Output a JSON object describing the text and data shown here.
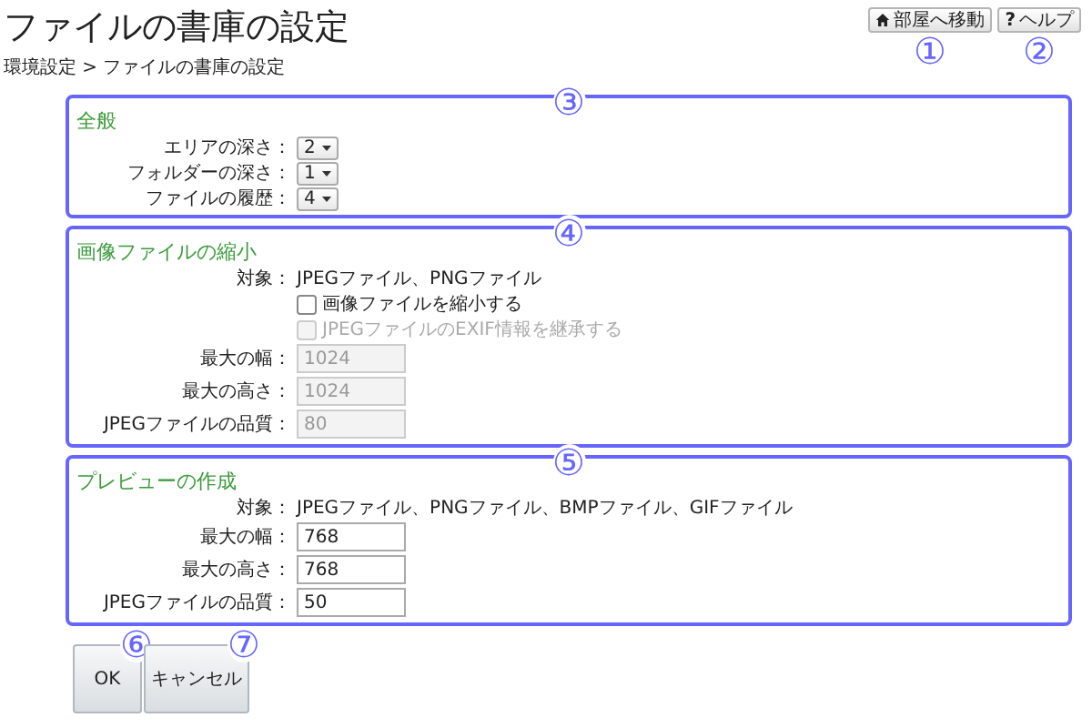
{
  "header": {
    "title": "ファイルの書庫の設定",
    "buttons": [
      {
        "kind": "home",
        "label": "部屋へ移動",
        "callout": "①"
      },
      {
        "kind": "help",
        "icon": "?",
        "label": "ヘルプ",
        "callout": "②"
      }
    ]
  },
  "breadcrumb": "環境設定 > ファイルの書庫の設定",
  "sections": [
    {
      "title": "全般",
      "callout": "③",
      "rows": [
        {
          "kind": "select",
          "label": "エリアの深さ：",
          "value": "2"
        },
        {
          "kind": "select",
          "label": "フォルダーの深さ：",
          "value": "1"
        },
        {
          "kind": "select",
          "label": "ファイルの履歴：",
          "value": "4"
        }
      ]
    },
    {
      "title": "画像ファイルの縮小",
      "callout": "④",
      "rows": [
        {
          "kind": "info",
          "label": "対象：",
          "value": "JPEGファイル、PNGファイル"
        },
        {
          "kind": "checkbox",
          "label": "画像ファイルを縮小する",
          "checked": false,
          "disabled": false
        },
        {
          "kind": "checkbox",
          "label": "JPEGファイルのEXIF情報を継承する",
          "checked": false,
          "disabled": true
        },
        {
          "kind": "input",
          "label": "最大の幅：",
          "value": "1024",
          "disabled": true
        },
        {
          "kind": "input",
          "label": "最大の高さ：",
          "value": "1024",
          "disabled": true
        },
        {
          "kind": "input",
          "label": "JPEGファイルの品質：",
          "value": "80",
          "disabled": true
        }
      ]
    },
    {
      "title": "プレビューの作成",
      "callout": "⑤",
      "rows": [
        {
          "kind": "info",
          "label": "対象：",
          "value": "JPEGファイル、PNGファイル、BMPファイル、GIFファイル"
        },
        {
          "kind": "input",
          "label": "最大の幅：",
          "value": "768",
          "disabled": false
        },
        {
          "kind": "input",
          "label": "最大の高さ：",
          "value": "768",
          "disabled": false
        },
        {
          "kind": "input",
          "label": "JPEGファイルの品質：",
          "value": "50",
          "disabled": false
        }
      ]
    }
  ],
  "buttons": [
    {
      "label": "OK",
      "callout": "⑥"
    },
    {
      "label": "キャンセル",
      "callout": "⑦"
    }
  ]
}
